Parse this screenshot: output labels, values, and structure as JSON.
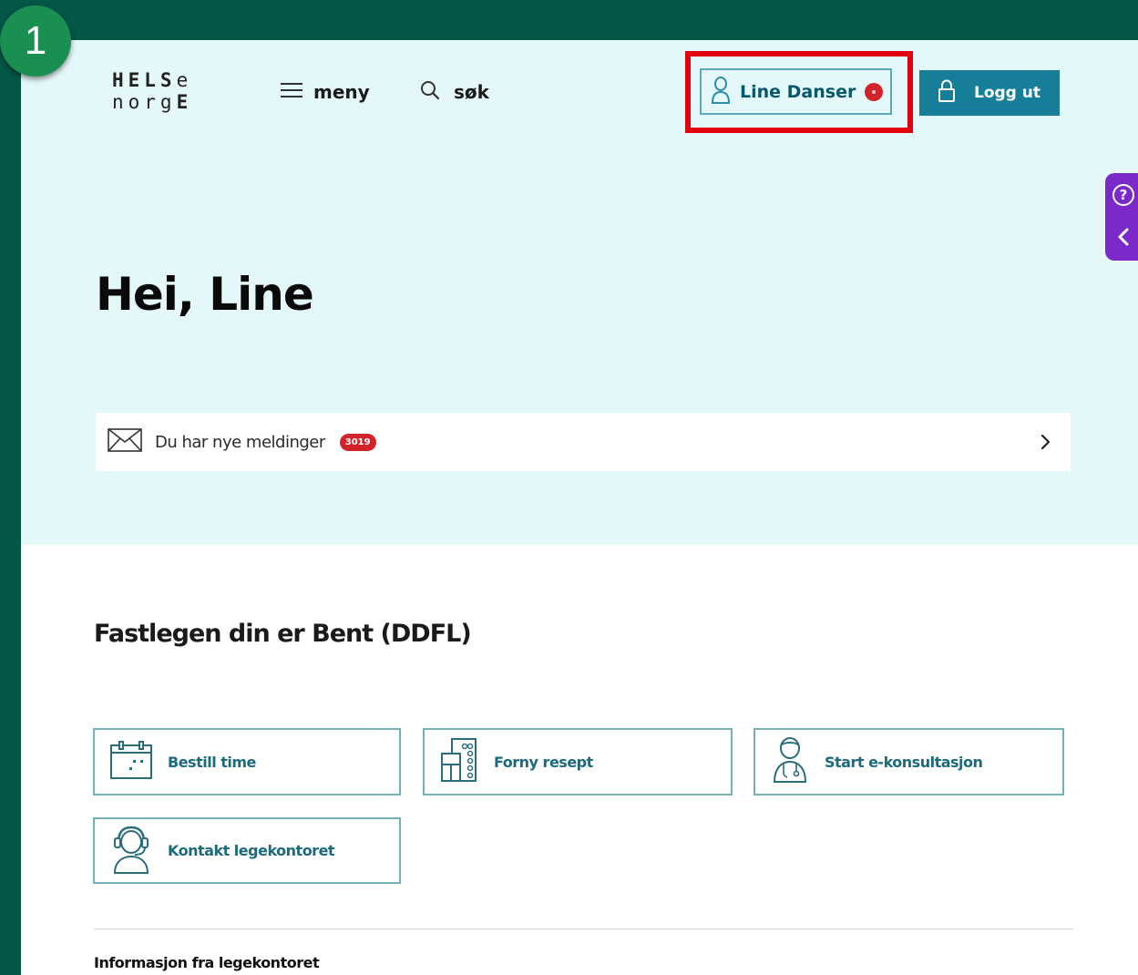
{
  "step_badge": "1",
  "logo": {
    "line1_bold": "HELS",
    "line1_thin": "e",
    "line2_thin": "norg",
    "line2_bold": "E"
  },
  "nav": {
    "menu_label": "meny",
    "menu_icon": "hamburger-icon",
    "search_label": "søk",
    "search_icon": "search-icon"
  },
  "user": {
    "name": "Line Danser",
    "icon": "user-icon",
    "notification_dot_color": "#d2232a",
    "highlight_color": "#e3000f"
  },
  "logout": {
    "label": "Logg ut",
    "icon": "lock-icon",
    "color": "#177e99"
  },
  "help_widget": {
    "help_symbol": "?",
    "icons": [
      "help-icon",
      "chevron-left-icon"
    ],
    "color": "#7b29c9"
  },
  "greeting": "Hei, Line",
  "messages": {
    "label": "Du har nye meldinger",
    "count": "3019",
    "icon": "envelope-icon"
  },
  "doctor": {
    "heading": "Fastlegen din er Bent (DDFL)",
    "actions": [
      {
        "label": "Bestill time",
        "icon": "calendar-icon"
      },
      {
        "label": "Forny resept",
        "icon": "prescription-icon"
      },
      {
        "label": "Start e-konsultasjon",
        "icon": "doctor-icon"
      },
      {
        "label": "Kontakt legekontoret",
        "icon": "headset-person-icon"
      }
    ]
  },
  "info_heading": "Informasjon fra legekontoret",
  "colors": {
    "frame": "#025747",
    "hero_background": "#e4f7f9",
    "step_badge": "#1a8f52",
    "card_border": "#72b0be"
  }
}
